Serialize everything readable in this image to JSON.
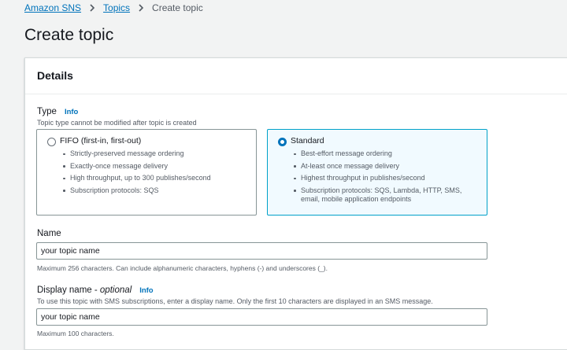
{
  "breadcrumb": {
    "items": [
      "Amazon SNS",
      "Topics"
    ],
    "current": "Create topic"
  },
  "page_title": "Create topic",
  "details": {
    "title": "Details",
    "type": {
      "label": "Type",
      "info": "Info",
      "description": "Topic type cannot be modified after topic is created",
      "options": {
        "fifo": {
          "label": "FIFO (first-in, first-out)",
          "selected": false,
          "features": [
            "Strictly-preserved message ordering",
            "Exactly-once message delivery",
            "High throughput, up to 300 publishes/second",
            "Subscription protocols: SQS"
          ]
        },
        "standard": {
          "label": "Standard",
          "selected": true,
          "features": [
            "Best-effort message ordering",
            "At-least once message delivery",
            "Highest throughput in publishes/second"
          ],
          "protocols_line1": "Subscription protocols: SQS, Lambda, HTTP, SMS,",
          "protocols_line2": "email, mobile application endpoints"
        }
      }
    },
    "name": {
      "label": "Name",
      "value": "your topic name",
      "constraint": "Maximum 256 characters. Can include alphanumeric characters, hyphens (-) and underscores (_)."
    },
    "display_name": {
      "label": "Display name",
      "optional": "optional",
      "info": "Info",
      "description": "To use this topic with SMS subscriptions, enter a display name. Only the first 10 characters are displayed in an SMS message.",
      "value": "your topic name",
      "constraint": "Maximum 100 characters."
    }
  },
  "colors": {
    "link": "#0073bb",
    "selected_border": "#00a1c9",
    "selected_bg": "#f1faff",
    "page_bg": "#f2f3f3"
  },
  "icons": {
    "breadcrumb_separator": "chevron-right-icon",
    "selected_radio": "radio-checked-icon",
    "unselected_radio": "radio-unchecked-icon"
  }
}
